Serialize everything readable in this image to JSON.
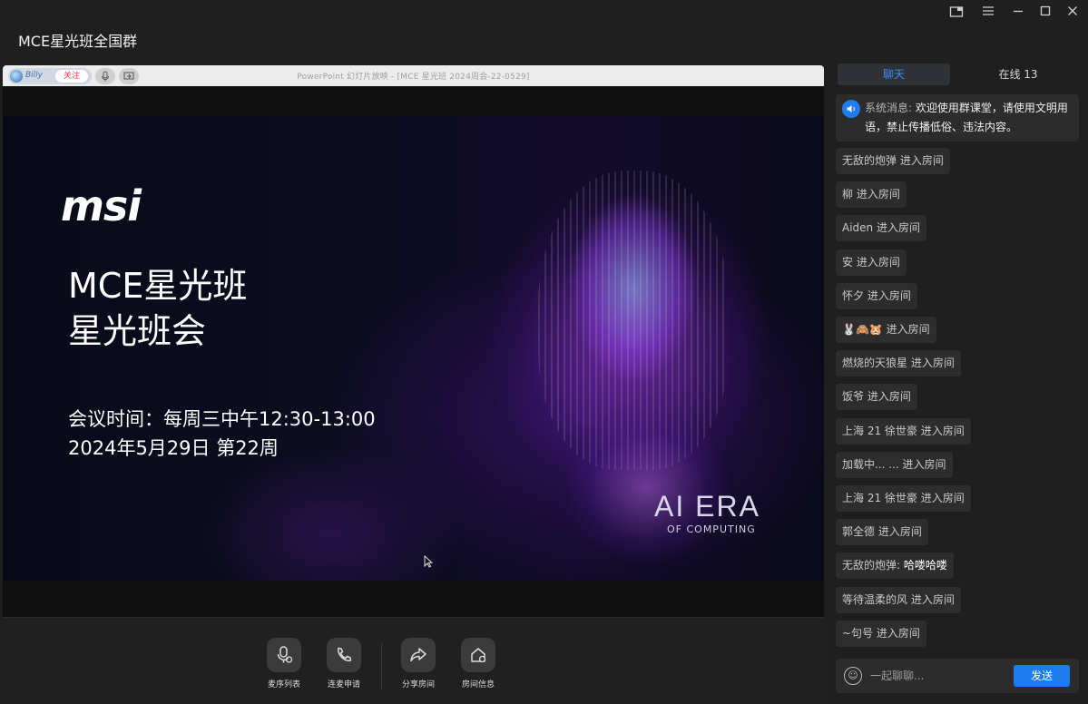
{
  "window": {
    "title": "MCE星光班全国群",
    "controls": [
      "screen-mode-icon",
      "menu-icon",
      "minimize-icon",
      "maximize-icon",
      "close-icon"
    ]
  },
  "presenter_bar": {
    "host_name": "Billy",
    "follow_label": "关注",
    "window_title": "PowerPoint 幻灯片放映 - [MCE 星光班 2024周会-22-0529]"
  },
  "slide": {
    "logo": "msi",
    "title_line1": "MCE星光班",
    "title_line2": "星光班会",
    "time_line1": "会议时间：每周三中午12:30-13:00",
    "time_line2": "2024年5月29日 第22周",
    "brand_line1": "AI ERA",
    "brand_line2": "OF COMPUTING"
  },
  "controls": [
    {
      "label": "麦序列表",
      "icon": "mic-list-icon"
    },
    {
      "label": "连麦申请",
      "icon": "phone-icon"
    },
    {
      "label": "分享房间",
      "icon": "share-icon"
    },
    {
      "label": "房间信息",
      "icon": "room-info-icon"
    }
  ],
  "chat": {
    "tab_chat": "聊天",
    "tab_online": "在线 13",
    "system_label": "系统消息:",
    "system_text": "欢迎使用群课堂，请使用文明用语，禁止传播低俗、违法内容。",
    "messages": [
      {
        "user": "无敌的炮弹",
        "text": "进入房间"
      },
      {
        "user": "柳",
        "text": "进入房间"
      },
      {
        "user": "Aiden",
        "text": "进入房间"
      },
      {
        "user": "安",
        "text": "进入房间"
      },
      {
        "user": "怀夕",
        "text": "进入房间"
      },
      {
        "user": "🐰🙈🐹",
        "text": "进入房间"
      },
      {
        "user": "燃烧的天狼星",
        "text": "进入房间"
      },
      {
        "user": "饭爷",
        "text": "进入房间"
      },
      {
        "user": "上海 21 徐世豪",
        "text": "进入房间"
      },
      {
        "user": "加载中... ...",
        "text": "进入房间"
      },
      {
        "user": "上海 21 徐世豪",
        "text": "进入房间"
      },
      {
        "user": "郭全德",
        "text": "进入房间"
      },
      {
        "user": "无敌的炮弹:",
        "text": "哈喽哈喽"
      },
      {
        "user": "等待温柔的风",
        "text": "进入房间"
      },
      {
        "user": "~句号",
        "text": "进入房间"
      }
    ],
    "input_placeholder": "一起聊聊...",
    "send_label": "发送"
  },
  "colors": {
    "accent": "#1f7cf0",
    "panel_bg": "#1f1f1f",
    "bubble_bg": "#2d2d2d"
  }
}
